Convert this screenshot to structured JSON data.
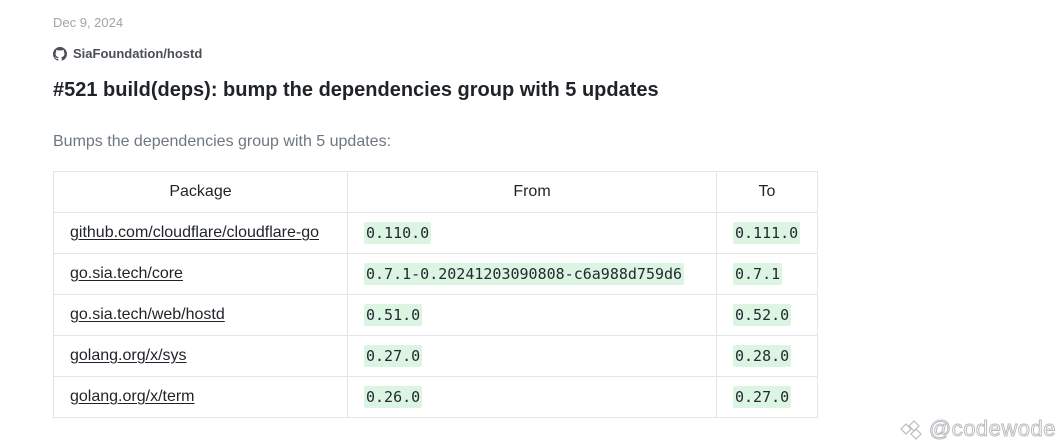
{
  "post": {
    "date": "Dec 9, 2024",
    "repo": "SiaFoundation/hostd",
    "title": "#521 build(deps): bump the dependencies group with 5 updates",
    "description": "Bumps the dependencies group with 5 updates:"
  },
  "table": {
    "headers": {
      "package": "Package",
      "from": "From",
      "to": "To"
    },
    "rows": [
      {
        "package": "github.com/cloudflare/cloudflare-go",
        "from": "0.110.0",
        "to": "0.111.0"
      },
      {
        "package": "go.sia.tech/core",
        "from": "0.7.1-0.20241203090808-c6a988d759d6",
        "to": "0.7.1"
      },
      {
        "package": "go.sia.tech/web/hostd",
        "from": "0.51.0",
        "to": "0.52.0"
      },
      {
        "package": "golang.org/x/sys",
        "from": "0.27.0",
        "to": "0.28.0"
      },
      {
        "package": "golang.org/x/term",
        "from": "0.26.0",
        "to": "0.27.0"
      }
    ]
  },
  "watermark": {
    "text": "@codewode"
  },
  "icons": {
    "repo": "github-icon",
    "watermark": "diamond-logo-icon"
  },
  "colors": {
    "version_highlight": "#dcf5e3",
    "muted_text": "#6e7781",
    "border": "#e3e5e8"
  }
}
